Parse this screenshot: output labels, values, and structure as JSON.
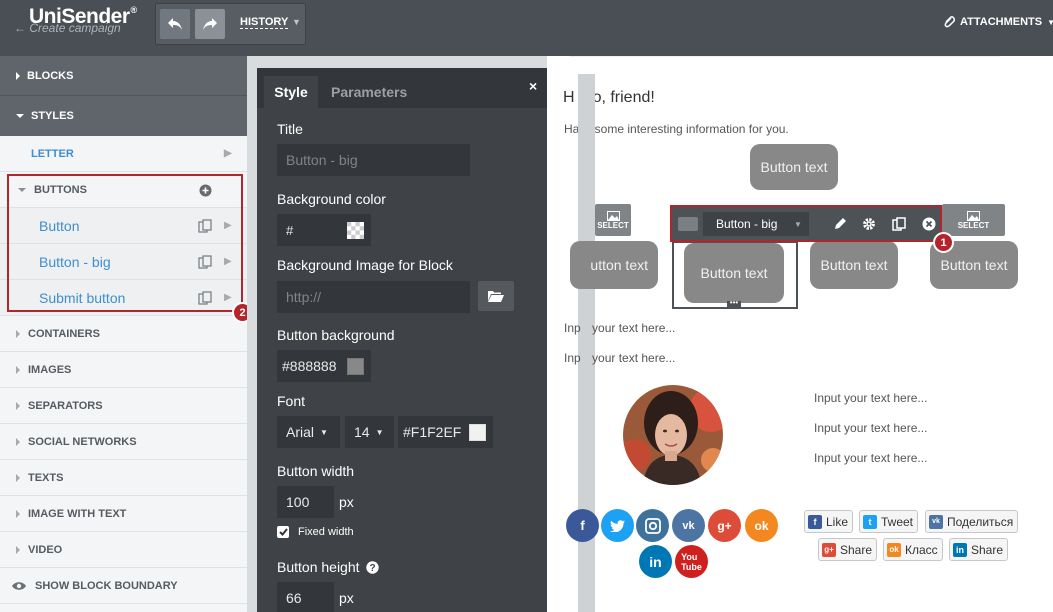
{
  "header": {
    "logo": "UniSender",
    "logo_mark": "®",
    "subtitle": "Create campaign",
    "history_label": "HISTORY",
    "attachments_label": "ATTACHMENTS"
  },
  "sidebar": {
    "blocks": "BLOCKS",
    "styles": "STYLES",
    "letter": "LETTER",
    "buttons": "BUTTONS",
    "button_items": [
      "Button",
      "Button - big",
      "Submit button"
    ],
    "sections": [
      "CONTAINERS",
      "IMAGES",
      "SEPARATORS",
      "SOCIAL NETWORKS",
      "TEXTS",
      "IMAGE WITH TEXT",
      "VIDEO"
    ],
    "show_boundary": "SHOW BLOCK BOUNDARY"
  },
  "badges": [
    "1",
    "2"
  ],
  "panel": {
    "tab_style": "Style",
    "tab_parameters": "Parameters",
    "close": "×",
    "title_label": "Title",
    "title_placeholder": "Button - big",
    "bg_color_label": "Background color",
    "bg_color_value": "#",
    "bg_image_label": "Background Image for Block",
    "bg_image_placeholder": "http://",
    "button_bg_label": "Button background",
    "button_bg_value": "#888888",
    "font_label": "Font",
    "font_family": "Arial",
    "font_size": "14",
    "font_color": "#F1F2EF",
    "width_label": "Button width",
    "width_value": "100",
    "width_unit": "px",
    "fixed_width": "Fixed width",
    "height_label": "Button height",
    "height_value": "66",
    "height_unit": "px"
  },
  "canvas": {
    "greeting": "Hello, friend!",
    "greeting_visible": "H",
    "greeting_rest": "o, friend!",
    "info_prefix": "Ha",
    "info_rest": " some interesting information for you.",
    "button_text": "Button text",
    "button_left_partial": "utton text",
    "select_label": "SELECT",
    "toolbar_select": "Button - big",
    "input_prefix": "Inp",
    "input_rest": " your text here...",
    "input_text": "Input your text here...",
    "share_buttons": [
      {
        "label": "Like",
        "color": "#3b5998",
        "icon": "f"
      },
      {
        "label": "Tweet",
        "color": "#1da1f2",
        "icon": "t"
      },
      {
        "label": "Поделиться",
        "color": "#4c75a3",
        "icon": "vk"
      },
      {
        "label": "Share",
        "color": "#dd4b39",
        "icon": "g+"
      },
      {
        "label": "Класс",
        "color": "#f2881f",
        "icon": "ok"
      },
      {
        "label": "Share",
        "color": "#0077b5",
        "icon": "in"
      }
    ]
  },
  "colors": {
    "accent_red": "#b3252c",
    "link_blue": "#3d8fcf",
    "button_bg": "#888888",
    "button_text": "#F1F2EF"
  }
}
